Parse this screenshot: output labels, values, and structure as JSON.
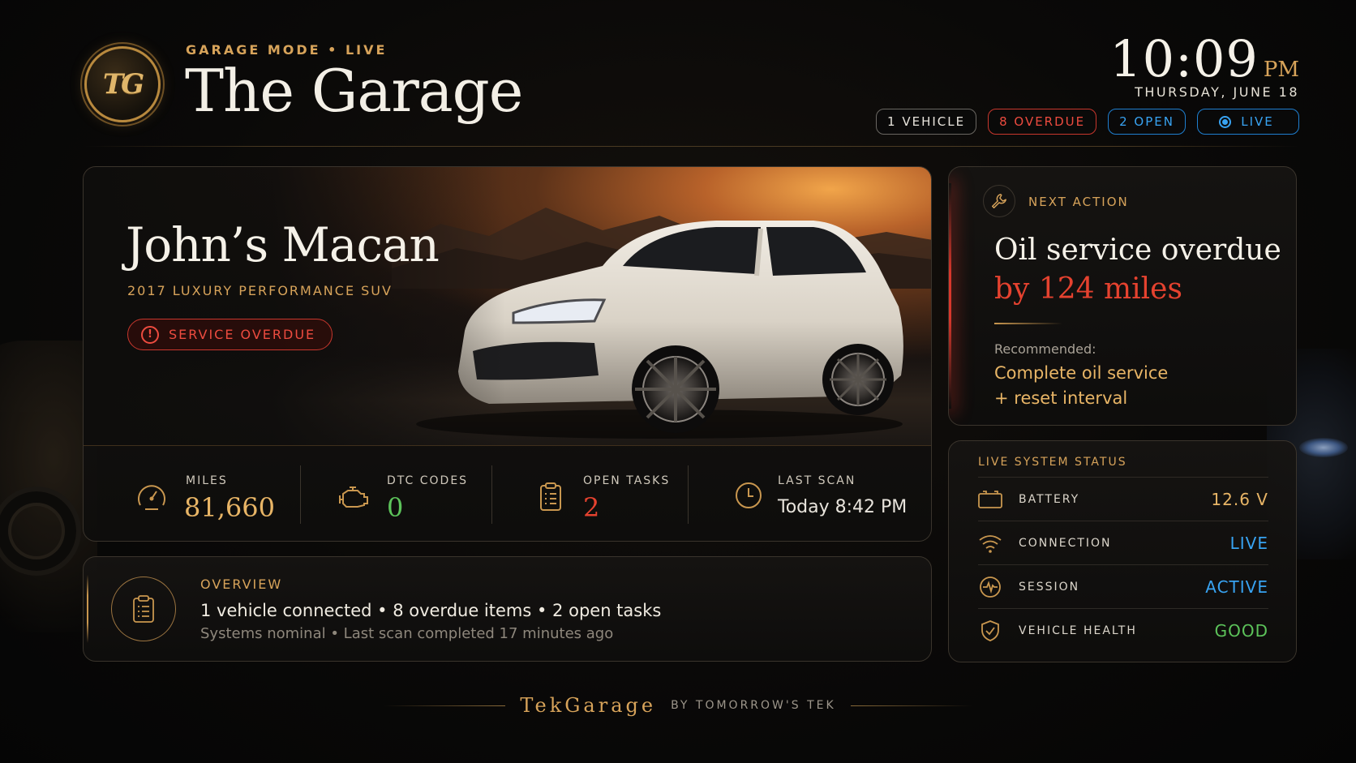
{
  "header": {
    "kicker": "GARAGE MODE • LIVE",
    "title": "The Garage",
    "logo_text": "TG",
    "time": "10:09",
    "ampm": "PM",
    "date": "THURSDAY, JUNE 18",
    "pills": {
      "vehicles": "1 VEHICLE",
      "overdue": "8 OVERDUE",
      "open": "2 OPEN",
      "live": "LIVE"
    }
  },
  "vehicle": {
    "name": "John’s Macan",
    "subtitle": "2017 LUXURY PERFORMANCE SUV",
    "badge": "SERVICE OVERDUE"
  },
  "stats": [
    {
      "label": "MILES",
      "value": "81,660",
      "icon": "speedometer-icon",
      "color": "#e8b566"
    },
    {
      "label": "DTC CODES",
      "value": "0",
      "icon": "engine-icon",
      "color": "#5cc35a"
    },
    {
      "label": "OPEN TASKS",
      "value": "2",
      "icon": "clipboard-icon",
      "color": "#e5422f"
    },
    {
      "label": "LAST SCAN",
      "value": "Today 8:42 PM",
      "icon": "clock-icon",
      "color": "#e8e4dc"
    }
  ],
  "next_action": {
    "kicker": "NEXT ACTION",
    "headline_1": "Oil service overdue",
    "headline_2": "by 124 miles",
    "recommended_label": "Recommended:",
    "recommended_1": "Complete oil service",
    "recommended_2": "+ reset interval"
  },
  "system_status": {
    "kicker": "LIVE SYSTEM STATUS",
    "rows": [
      {
        "label": "BATTERY",
        "value": "12.6 V",
        "icon": "battery-icon",
        "color": "#e8b566"
      },
      {
        "label": "CONNECTION",
        "value": "LIVE",
        "icon": "wifi-icon",
        "color": "#38a3f2"
      },
      {
        "label": "SESSION",
        "value": "ACTIVE",
        "icon": "pulse-icon",
        "color": "#38a3f2"
      },
      {
        "label": "VEHICLE HEALTH",
        "value": "GOOD",
        "icon": "shield-check-icon",
        "color": "#5cc35a"
      }
    ]
  },
  "overview": {
    "kicker": "OVERVIEW",
    "line1": "1 vehicle connected  •  8 overdue items  •  2 open tasks",
    "line2": "Systems nominal  •  Last scan completed 17 minutes ago"
  },
  "footer": {
    "brand": "TekGarage",
    "by": "BY TOMORROW'S TEK"
  },
  "colors": {
    "gold": "#d7a35a",
    "alert_red": "#e5422f",
    "live_blue": "#38a3f2",
    "ok_green": "#5cc35a"
  }
}
